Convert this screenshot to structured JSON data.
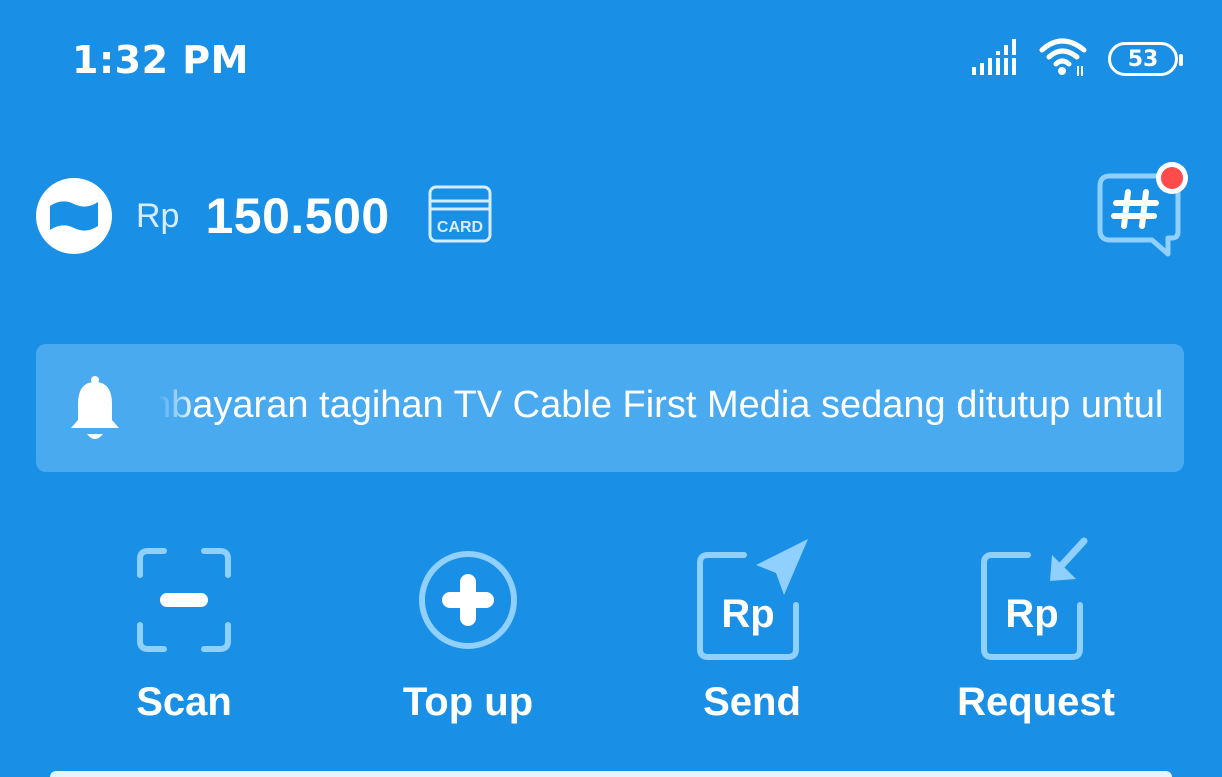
{
  "status_bar": {
    "time": "1:32 PM",
    "battery": "53",
    "icons": [
      "signal-icon",
      "wifi-icon",
      "battery-icon"
    ]
  },
  "wallet": {
    "currency": "Rp",
    "balance": "150.500",
    "card_label": "CARD"
  },
  "notice": {
    "text": "nbayaran tagihan TV Cable First Media sedang ditutup untul"
  },
  "actions": [
    {
      "label": "Scan",
      "icon": "scan-icon"
    },
    {
      "label": "Top up",
      "icon": "plus-circle-icon"
    },
    {
      "label": "Send",
      "icon": "send-rp-icon"
    },
    {
      "label": "Request",
      "icon": "request-rp-icon"
    }
  ],
  "colors": {
    "background": "#1a8fe6",
    "notice_bg": "#4aaaf0",
    "icon_light": "#8fd0ff",
    "badge": "#ff4b4b"
  }
}
